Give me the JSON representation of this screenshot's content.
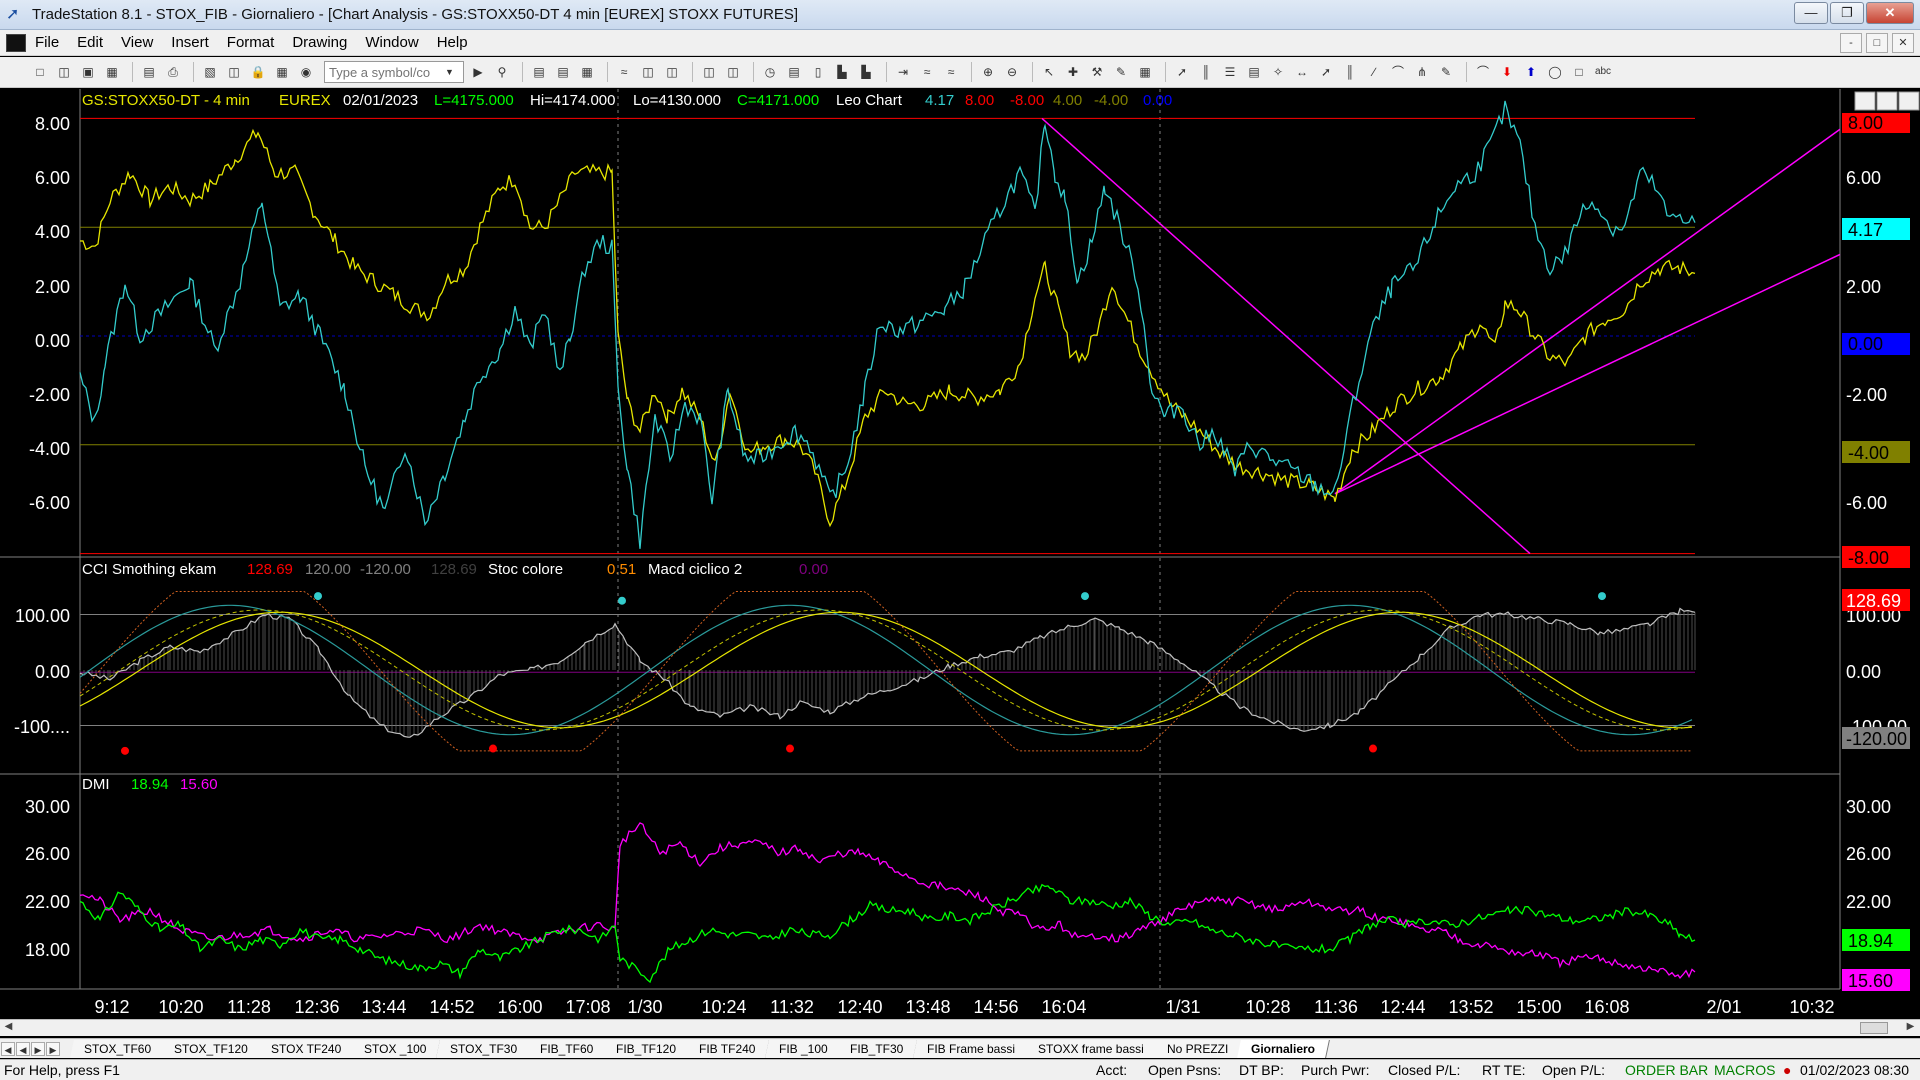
{
  "window": {
    "title": "TradeStation 8.1 - STOX_FIB - Giornaliero - [Chart Analysis - GS:STOXX50-DT  4 min  [EUREX] STOXX FUTURES]",
    "min_label": "—",
    "max_label": "❐",
    "close_label": "✕"
  },
  "menu": [
    "File",
    "Edit",
    "View",
    "Insert",
    "Format",
    "Drawing",
    "Window",
    "Help"
  ],
  "mdi": {
    "min": "-",
    "restore": "□",
    "close": "✕"
  },
  "toolbar": {
    "symbol_placeholder": "Type a symbol/co"
  },
  "chart": {
    "header": {
      "symbol": "GS:STOXX50-DT - 4 min",
      "exchange": "EUREX",
      "date": "02/01/2023",
      "last": "L=4175.000",
      "high": "Hi=4174.000",
      "low": "Lo=4130.000",
      "close": "C=4171.000",
      "study": "Leo Chart",
      "v1": "4.17",
      "v2": "8.00",
      "v3": "-8.00",
      "v4": "4.00",
      "v5": "-4.00",
      "v6": "0.00"
    },
    "panel1": {
      "y_ticks": [
        "8.00",
        "6.00",
        "4.00",
        "2.00",
        "0.00",
        "-2.00",
        "-4.00",
        "-6.00"
      ],
      "right_ticks": [
        "6.00",
        "2.00",
        "-2.00",
        "-6.00"
      ],
      "tags": [
        {
          "text": "8.00",
          "color": "#ff0000",
          "fg": "#000000"
        },
        {
          "text": "4.17",
          "color": "#00ffff",
          "fg": "#000000"
        },
        {
          "text": "0.00",
          "color": "#0000ff",
          "fg": "#000000"
        },
        {
          "text": "-4.00",
          "color": "#808000",
          "fg": "#000000"
        },
        {
          "text": "-8.00",
          "color": "#ff0000",
          "fg": "#000000"
        }
      ]
    },
    "panel2": {
      "name": "CCI Smothing ekam",
      "v1": "128.69",
      "v2": "120.00",
      "v3": "-120.00",
      "v4": "128.69",
      "name2": "Stoc colore",
      "v5": "0.51",
      "name3": "Macd ciclico 2",
      "v6": "0.00",
      "y_ticks": [
        "100.00",
        "0.00",
        "-100...."
      ],
      "right_ticks": [
        "100.00",
        "0.00",
        "-100.00"
      ],
      "tags": [
        {
          "text": "128.69",
          "color": "#ff0000",
          "fg": "#ffffff"
        },
        {
          "text": "-120.00",
          "color": "#808080",
          "fg": "#000000"
        }
      ]
    },
    "panel3": {
      "name": "DMI",
      "v1": "18.94",
      "v2": "15.60",
      "y_ticks": [
        "30.00",
        "26.00",
        "22.00",
        "18.00"
      ],
      "right_ticks": [
        "30.00",
        "26.00",
        "22.00"
      ],
      "tags": [
        {
          "text": "18.94",
          "color": "#00ff00",
          "fg": "#000000"
        },
        {
          "text": "15.60",
          "color": "#ff00ff",
          "fg": "#000000"
        }
      ]
    },
    "x_labels": [
      "9:12",
      "10:20",
      "11:28",
      "12:36",
      "13:44",
      "14:52",
      "16:00",
      "17:08",
      "1/30",
      "10:24",
      "11:32",
      "12:40",
      "13:48",
      "14:56",
      "16:04",
      "1/31",
      "10:28",
      "11:36",
      "12:44",
      "13:52",
      "15:00",
      "16:08",
      "2/01",
      "10:32"
    ],
    "colors": {
      "cyan": "#33cccc",
      "yellow": "#e6e600",
      "magenta": "#ff00ff",
      "red": "#ff0000",
      "olive": "#808000",
      "green": "#00ff00",
      "grid": "#808080"
    }
  },
  "tabs": [
    "STOX_TF60",
    "STOX_TF120",
    "STOX TF240",
    "STOX _100",
    "STOX_TF30",
    "FIB_TF60",
    "FIB_TF120",
    "FIB TF240",
    "FIB _100",
    "FIB_TF30",
    "FIB Frame bassi",
    "STOXX frame bassi",
    "No PREZZI",
    "Giornaliero"
  ],
  "status": {
    "help": "For Help, press F1",
    "acct": "Acct:",
    "open_psns": "Open Psns:",
    "dt_bp": "DT BP:",
    "purch_pwr": "Purch Pwr:",
    "closed_pl": "Closed P/L:",
    "rt_te": "RT TE:",
    "open_pl": "Open P/L:",
    "order_bar": "ORDER BAR",
    "macros": "MACROS",
    "datetime": "01/02/2023 08:30"
  }
}
